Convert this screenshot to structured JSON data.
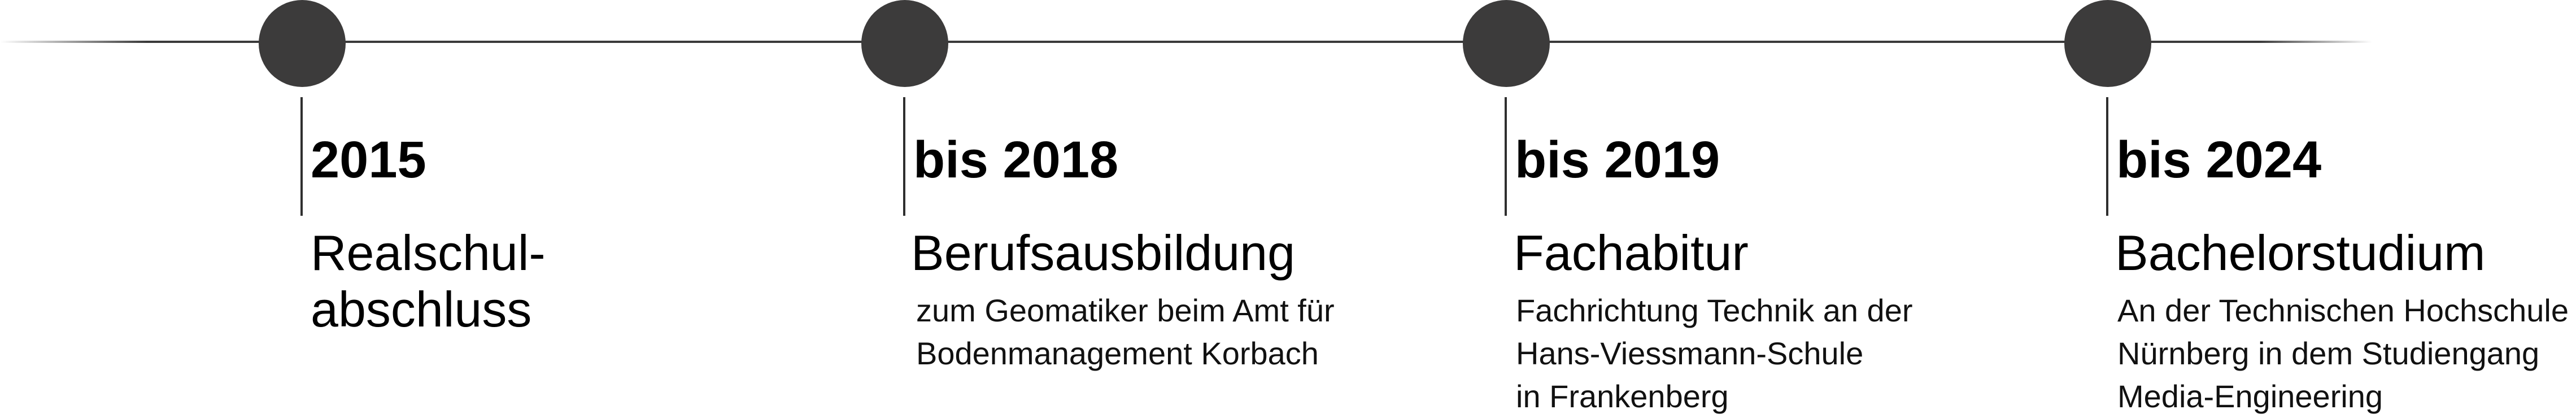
{
  "timeline": {
    "milestones": [
      {
        "year": "2015",
        "title_lines": [
          "Realschul-",
          "abschluss"
        ],
        "description_lines": []
      },
      {
        "year": "bis 2018",
        "title_lines": [
          "Berufsausbildung"
        ],
        "description_lines": [
          "zum Geomatiker beim Amt für",
          "Bodenmanagement Korbach"
        ]
      },
      {
        "year": "bis 2019",
        "title_lines": [
          "Fachabitur"
        ],
        "description_lines": [
          "Fachrichtung Technik an der",
          "Hans-Viessmann-Schule",
          "in Frankenberg"
        ]
      },
      {
        "year": "bis 2024",
        "title_lines": [
          "Bachelorstudium"
        ],
        "description_lines": [
          "An der Technischen Hochschule",
          "Nürnberg in dem Studiengang",
          "Media-Engineering"
        ]
      }
    ],
    "colors": {
      "dot": "#3c3b3b",
      "line": "#3a3a3a",
      "text": "#000000"
    }
  }
}
